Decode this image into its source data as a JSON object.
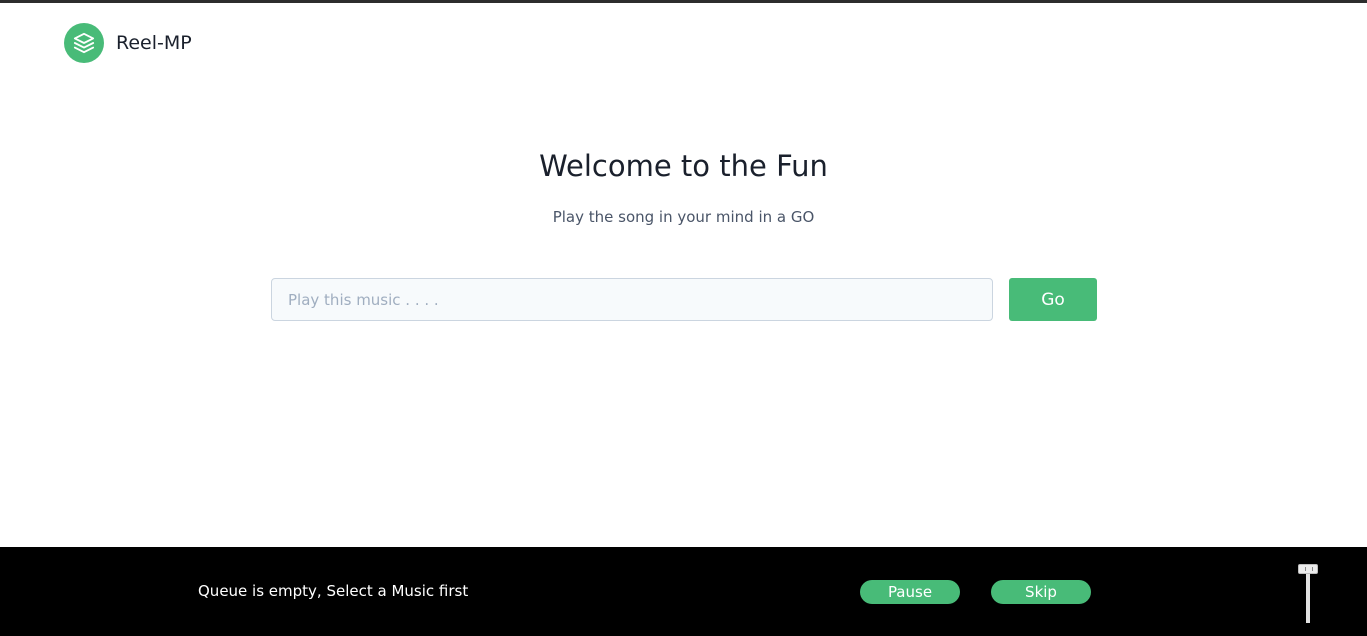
{
  "header": {
    "brand": "Reel-MP",
    "logo_icon": "layers-icon"
  },
  "hero": {
    "title": "Welcome to the Fun",
    "subtitle": "Play the song in your mind in a GO"
  },
  "search": {
    "placeholder": "Play this music . . . .",
    "value": "",
    "go_label": "Go"
  },
  "player": {
    "status": "Queue is empty, Select a Music first",
    "pause_label": "Pause",
    "skip_label": "Skip",
    "volume_level": 1.0
  },
  "colors": {
    "accent": "#48bb78",
    "player_background": "#000000",
    "text_primary": "#1a202c"
  }
}
